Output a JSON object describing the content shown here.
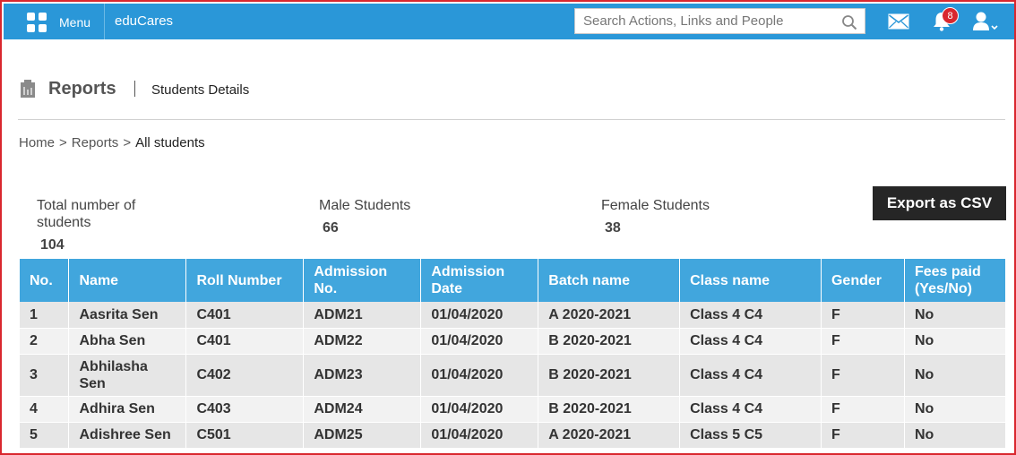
{
  "topbar": {
    "menu_label": "Menu",
    "app_name": "eduCares",
    "search_placeholder": "Search Actions, Links and People",
    "notification_count": "8"
  },
  "header": {
    "title": "Reports",
    "subtitle": "Students Details"
  },
  "breadcrumb": {
    "home": "Home",
    "reports": "Reports",
    "current": "All students",
    "separator": ">"
  },
  "stats": {
    "total_label": "Total number of students",
    "total_value": "104",
    "male_label": "Male Students",
    "male_value": "66",
    "female_label": "Female Students",
    "female_value": "38"
  },
  "export_label": "Export as CSV",
  "table": {
    "headers": [
      "No.",
      "Name",
      "Roll Number",
      "Admission No.",
      "Admission Date",
      "Batch name",
      "Class name",
      "Gender",
      "Fees paid (Yes/No)"
    ],
    "rows": [
      [
        "1",
        "Aasrita Sen",
        "C401",
        "ADM21",
        "01/04/2020",
        "A 2020-2021",
        "Class 4 C4",
        "F",
        "No"
      ],
      [
        "2",
        "Abha Sen",
        "C401",
        "ADM22",
        "01/04/2020",
        "B 2020-2021",
        "Class 4 C4",
        "F",
        "No"
      ],
      [
        "3",
        "Abhilasha Sen",
        "C402",
        "ADM23",
        "01/04/2020",
        "B 2020-2021",
        "Class 4 C4",
        "F",
        "No"
      ],
      [
        "4",
        "Adhira Sen",
        "C403",
        "ADM24",
        "01/04/2020",
        "B 2020-2021",
        "Class 4 C4",
        "F",
        "No"
      ],
      [
        "5",
        "Adishree Sen",
        "C501",
        "ADM25",
        "01/04/2020",
        "A 2020-2021",
        "Class 5 C5",
        "F",
        "No"
      ]
    ]
  },
  "colors": {
    "topbar": "#2a97d8",
    "table_header": "#41a6dd",
    "frame": "#d9272e",
    "export_button": "#262626"
  }
}
